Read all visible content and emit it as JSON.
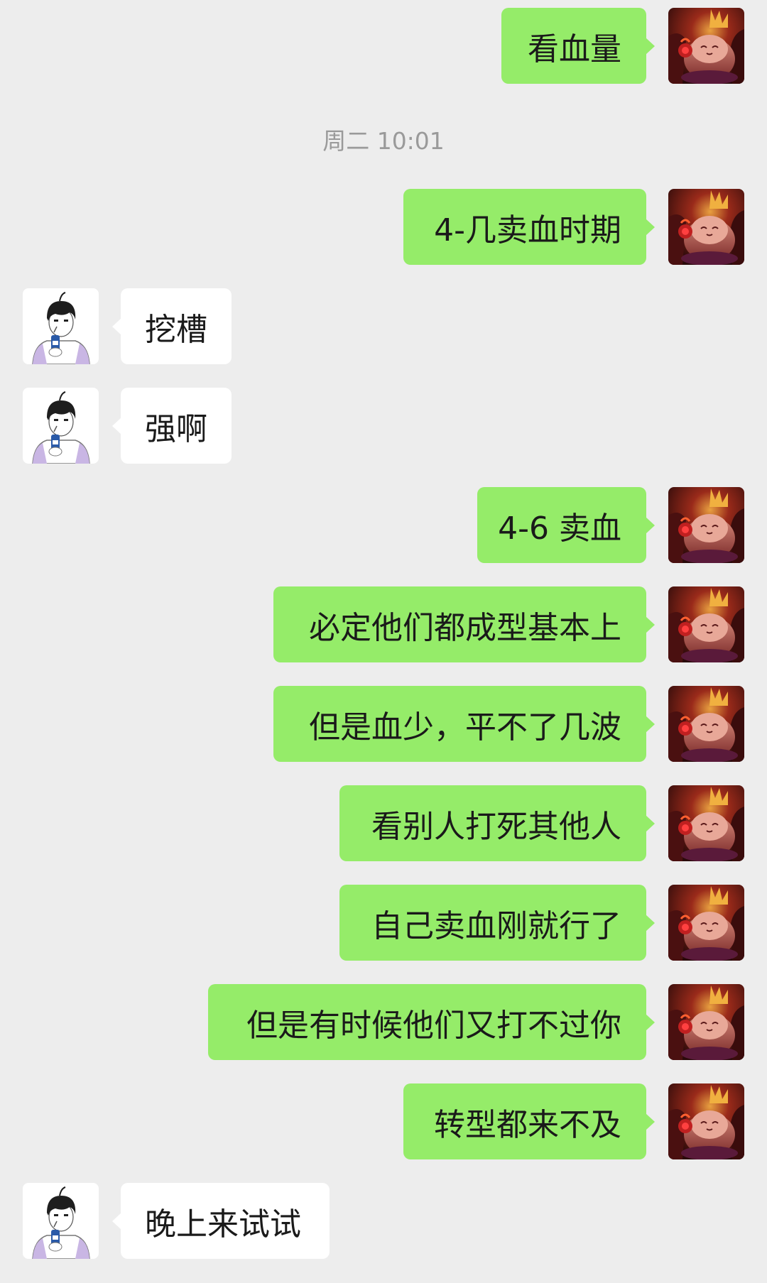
{
  "messages": [
    {
      "side": "out",
      "text": "看血量"
    },
    {
      "side": "out",
      "text": "4-几卖血时期"
    },
    {
      "side": "in",
      "text": "挖槽"
    },
    {
      "side": "in",
      "text": "强啊"
    },
    {
      "side": "out",
      "text": "4-6 卖血"
    },
    {
      "side": "out",
      "text": "必定他们都成型基本上"
    },
    {
      "side": "out",
      "text": "但是血少，平不了几波"
    },
    {
      "side": "out",
      "text": "看别人打死其他人"
    },
    {
      "side": "out",
      "text": "自己卖血刚就行了"
    },
    {
      "side": "out",
      "text": "但是有时候他们又打不过你"
    },
    {
      "side": "out",
      "text": "转型都来不及"
    },
    {
      "side": "in",
      "text": "晚上来试试"
    }
  ],
  "timestamp": "周二 10:01",
  "colors": {
    "background": "#ededed",
    "outgoing_bubble": "#95ec69",
    "incoming_bubble": "#ffffff",
    "timestamp_text": "#9a9a9a"
  },
  "icons": {
    "self_avatar": "demon-cat-avatar",
    "other_avatar": "anime-boy-avatar"
  }
}
